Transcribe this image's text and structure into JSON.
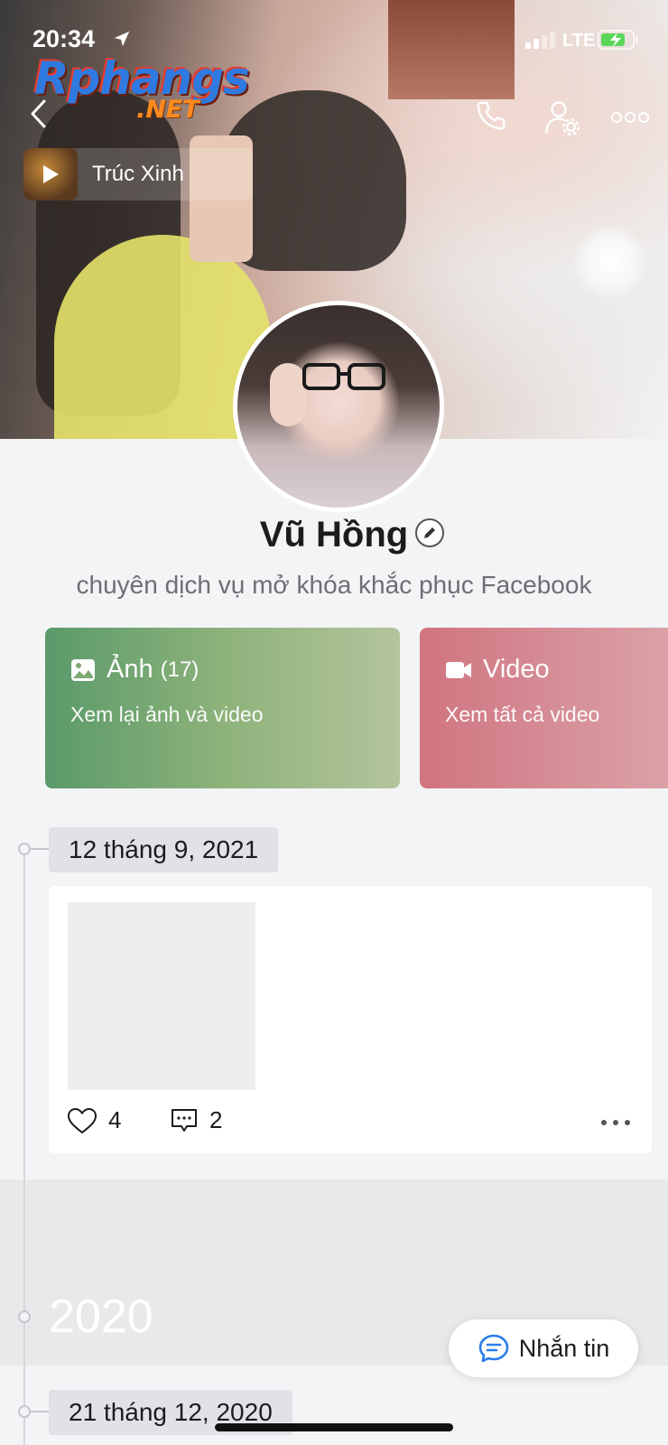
{
  "status_bar": {
    "time": "20:34",
    "network": "LTE"
  },
  "watermark": {
    "line1": "Rphangs",
    "line2": ".NET"
  },
  "music": {
    "title": "Trúc Xinh"
  },
  "profile": {
    "name": "Vũ Hồng",
    "bio": "chuyên dịch vụ mở khóa khắc phục Facebook"
  },
  "cards": {
    "photos": {
      "title": "Ảnh",
      "count": "(17)",
      "subtitle": "Xem lại ảnh và video"
    },
    "videos": {
      "title": "Video",
      "subtitle": "Xem tất cả video"
    }
  },
  "timeline": {
    "date1": "12 tháng 9, 2021",
    "post1": {
      "likes": "4",
      "comments": "2"
    },
    "year": "2020",
    "date2": "21 tháng 12, 2020"
  },
  "message_button": {
    "label": "Nhắn tin"
  },
  "colors": {
    "photo_card": "#5a9a6a",
    "video_card": "#d07480",
    "message_icon": "#2b7de9"
  }
}
